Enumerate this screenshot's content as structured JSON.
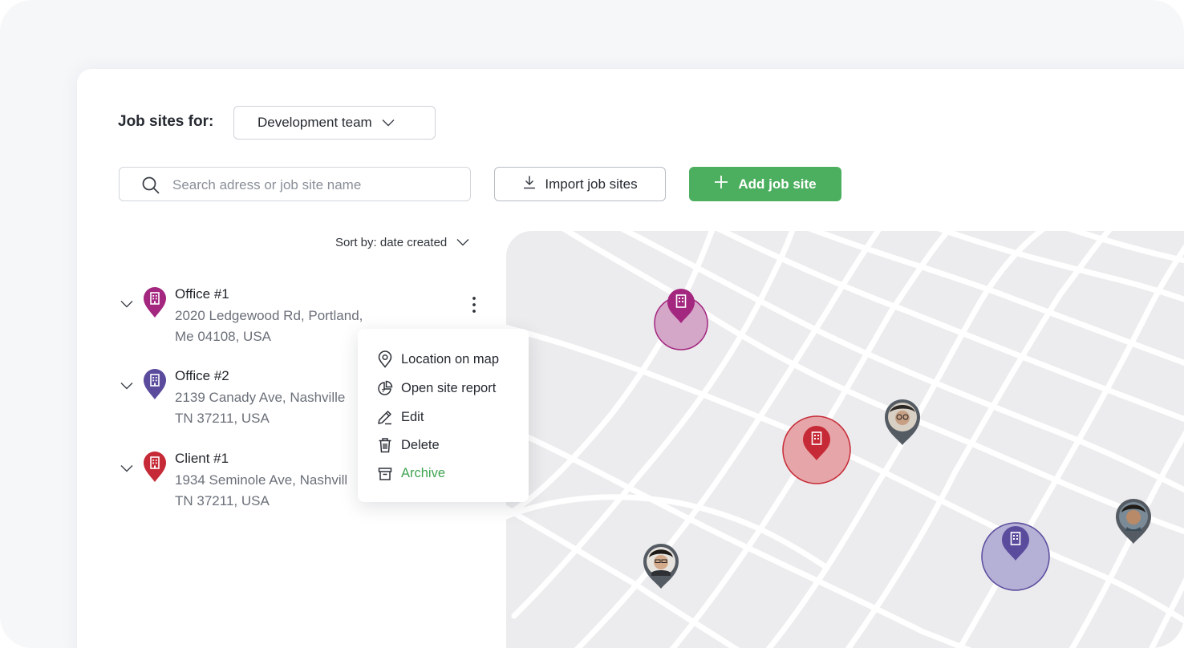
{
  "header": {
    "job_sites_for_label": "Job sites for:",
    "team_select_value": "Development team"
  },
  "toolbar": {
    "search_placeholder": "Search adress or job site name",
    "import_label": "Import job sites",
    "add_label": "Add job site"
  },
  "sort": {
    "label": "Sort by: date created"
  },
  "sites": [
    {
      "name": "Office #1",
      "address_line1": "2020 Ledgewood Rd, Portland,",
      "address_line2": "Me 04108, USA",
      "color": "#a3267f"
    },
    {
      "name": "Office #2",
      "address_line1": "2139 Canady Ave, Nashville",
      "address_line2": "TN 37211, USA",
      "color": "#5b4b9d"
    },
    {
      "name": "Client #1",
      "address_line1": "1934 Seminole Ave, Nashvill",
      "address_line2": "TN 37211, USA",
      "color": "#c62a36"
    }
  ],
  "context_menu": {
    "items": [
      {
        "label": "Location on map",
        "icon": "map-pin-icon"
      },
      {
        "label": "Open site report",
        "icon": "pie-chart-icon"
      },
      {
        "label": "Edit",
        "icon": "pencil-icon"
      },
      {
        "label": "Delete",
        "icon": "trash-icon"
      },
      {
        "label": "Archive",
        "icon": "archive-icon"
      }
    ]
  },
  "colors": {
    "accent_green": "#4caf5f",
    "office1": "#a3267f",
    "office2": "#5b4b9d",
    "client1": "#c62a36"
  }
}
